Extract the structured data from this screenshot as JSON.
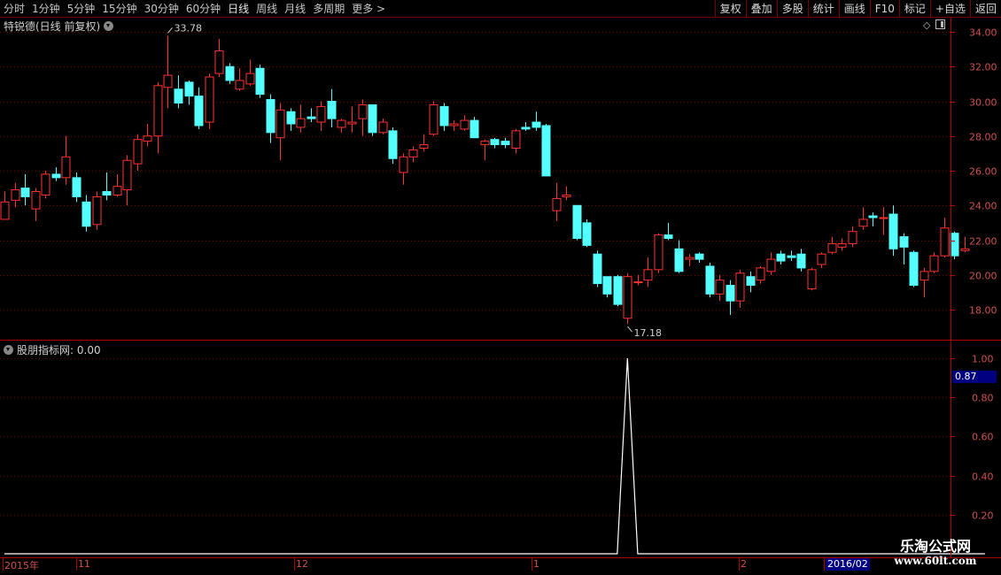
{
  "toolbar": {
    "left": [
      "分时",
      "1分钟",
      "5分钟",
      "15分钟",
      "30分钟",
      "60分钟",
      "日线",
      "周线",
      "月线",
      "多周期",
      "更多 >"
    ],
    "right": [
      "复权",
      "叠加",
      "多股",
      "统计",
      "画线",
      "F10",
      "标记",
      "+自选",
      "返回"
    ]
  },
  "stock_title": "特锐德(日线 前复权)",
  "indicator": {
    "name": "股朋指标网",
    "value": ": 0.00",
    "current": "0.87"
  },
  "price_axis": [
    "34.00",
    "32.00",
    "30.00",
    "28.00",
    "26.00",
    "24.00",
    "22.00",
    "20.00",
    "18.00"
  ],
  "indicator_axis": [
    "1.00",
    "0.80",
    "0.60",
    "0.40",
    "0.20"
  ],
  "annotations": {
    "high": "33.78",
    "low": "17.18"
  },
  "date_labels": [
    "2015年",
    "11",
    "12",
    "1",
    "2"
  ],
  "date_highlight": "2016/02",
  "watermark": {
    "line1": "乐淘公式网",
    "line2": "www.60lt.com"
  },
  "colors": {
    "up": "#ff3232",
    "down": "#54ffff",
    "grid": "#7a0000",
    "line": "#ffffff"
  },
  "chart_data": [
    {
      "type": "candlestick",
      "title": "特锐德(日线 前复权)",
      "ylim": [
        16.5,
        34.8
      ],
      "candles": [
        [
          23.2,
          24.2,
          23.3,
          24.8
        ],
        [
          24.3,
          24.9,
          23.9,
          25.3
        ],
        [
          25.0,
          24.5,
          24.0,
          25.8
        ],
        [
          23.8,
          24.8,
          23.1,
          25.0
        ],
        [
          24.6,
          25.8,
          24.4,
          26.0
        ],
        [
          25.8,
          25.6,
          25.4,
          26.2
        ],
        [
          25.6,
          26.8,
          25.2,
          28.0
        ],
        [
          25.6,
          24.5,
          24.2,
          25.9
        ],
        [
          24.2,
          22.8,
          22.5,
          24.6
        ],
        [
          22.9,
          24.5,
          22.6,
          24.8
        ],
        [
          24.8,
          24.6,
          24.3,
          25.9
        ],
        [
          24.6,
          25.1,
          24.5,
          25.8
        ],
        [
          24.9,
          26.6,
          24.0,
          26.9
        ],
        [
          26.4,
          27.8,
          26.0,
          28.1
        ],
        [
          27.7,
          28.0,
          27.4,
          28.7
        ],
        [
          28.0,
          30.9,
          27.0,
          31.1
        ],
        [
          30.8,
          31.5,
          29.6,
          33.78
        ],
        [
          30.7,
          29.9,
          29.6,
          31.5
        ],
        [
          31.1,
          30.3,
          29.8,
          31.2
        ],
        [
          30.3,
          28.6,
          28.4,
          30.8
        ],
        [
          28.8,
          31.4,
          28.4,
          31.6
        ],
        [
          31.6,
          32.9,
          31.4,
          33.6
        ],
        [
          32.0,
          31.2,
          31.0,
          32.2
        ],
        [
          30.7,
          31.2,
          30.6,
          31.9
        ],
        [
          31.0,
          31.6,
          30.9,
          32.4
        ],
        [
          31.9,
          30.4,
          30.2,
          32.1
        ],
        [
          30.1,
          28.2,
          27.6,
          30.4
        ],
        [
          27.9,
          29.5,
          26.6,
          29.9
        ],
        [
          29.4,
          28.7,
          28.3,
          29.6
        ],
        [
          28.5,
          29.0,
          28.2,
          29.8
        ],
        [
          29.1,
          29.0,
          28.8,
          29.6
        ],
        [
          28.8,
          29.7,
          28.3,
          30.0
        ],
        [
          30.0,
          29.0,
          28.5,
          30.7
        ],
        [
          28.5,
          28.9,
          28.2,
          29.0
        ],
        [
          28.7,
          28.8,
          28.2,
          29.7
        ],
        [
          29.0,
          29.8,
          28.0,
          30.1
        ],
        [
          29.8,
          28.2,
          28.0,
          29.8
        ],
        [
          28.2,
          28.8,
          28.1,
          29.0
        ],
        [
          28.3,
          26.7,
          26.4,
          28.5
        ],
        [
          25.9,
          26.8,
          25.2,
          27.0
        ],
        [
          26.8,
          27.2,
          26.5,
          27.4
        ],
        [
          27.3,
          27.5,
          27.1,
          28.1
        ],
        [
          28.1,
          29.8,
          28.0,
          30.0
        ],
        [
          29.7,
          28.6,
          28.3,
          29.9
        ],
        [
          28.6,
          28.7,
          28.3,
          28.9
        ],
        [
          28.4,
          28.9,
          28.3,
          29.2
        ],
        [
          28.9,
          27.9,
          27.9,
          29.1
        ],
        [
          27.5,
          27.7,
          26.6,
          27.8
        ],
        [
          27.8,
          27.5,
          27.3,
          27.9
        ],
        [
          27.7,
          27.5,
          27.3,
          27.9
        ],
        [
          27.3,
          28.3,
          27.0,
          28.4
        ],
        [
          28.5,
          28.4,
          28.3,
          28.8
        ],
        [
          28.8,
          28.5,
          28.3,
          29.4
        ],
        [
          28.6,
          25.7,
          25.7,
          28.7
        ],
        [
          23.7,
          24.4,
          23.1,
          25.3
        ],
        [
          24.5,
          24.6,
          24.3,
          25.1
        ],
        [
          24.0,
          22.1,
          22.0,
          24.0
        ],
        [
          23.0,
          21.7,
          21.6,
          23.2
        ],
        [
          21.2,
          19.5,
          19.3,
          21.4
        ],
        [
          19.9,
          18.9,
          18.7,
          19.9
        ],
        [
          19.9,
          18.3,
          18.2,
          20.0
        ],
        [
          17.5,
          19.9,
          17.18,
          20.1
        ],
        [
          19.6,
          19.6,
          19.4,
          20.0
        ],
        [
          19.7,
          20.3,
          19.3,
          21.0
        ],
        [
          20.3,
          22.3,
          20.1,
          22.4
        ],
        [
          22.3,
          22.1,
          22.0,
          23.0
        ],
        [
          21.5,
          20.2,
          20.1,
          22.0
        ],
        [
          20.9,
          21.0,
          20.5,
          21.2
        ],
        [
          21.2,
          20.9,
          20.7,
          21.3
        ],
        [
          20.5,
          18.9,
          18.7,
          20.7
        ],
        [
          18.9,
          19.7,
          18.5,
          20.0
        ],
        [
          19.4,
          18.5,
          17.7,
          19.7
        ],
        [
          18.5,
          20.1,
          18.1,
          20.3
        ],
        [
          19.9,
          19.4,
          19.0,
          20.2
        ],
        [
          19.7,
          20.4,
          19.5,
          20.5
        ],
        [
          20.2,
          20.9,
          20.0,
          21.3
        ],
        [
          21.2,
          20.8,
          20.6,
          21.4
        ],
        [
          21.1,
          21.0,
          20.8,
          21.4
        ],
        [
          21.2,
          20.4,
          20.2,
          21.5
        ],
        [
          19.2,
          20.3,
          19.1,
          20.4
        ],
        [
          20.6,
          21.2,
          20.4,
          21.3
        ],
        [
          21.3,
          21.8,
          21.2,
          22.2
        ],
        [
          21.6,
          21.8,
          21.4,
          22.1
        ],
        [
          21.8,
          22.5,
          21.6,
          22.8
        ],
        [
          22.8,
          23.2,
          22.6,
          23.9
        ],
        [
          23.4,
          23.3,
          22.8,
          23.6
        ],
        [
          23.3,
          23.3,
          22.3,
          23.9
        ],
        [
          23.5,
          21.5,
          21.1,
          24.0
        ],
        [
          22.2,
          21.6,
          20.6,
          22.4
        ],
        [
          21.3,
          19.4,
          19.3,
          21.4
        ],
        [
          19.7,
          20.2,
          18.7,
          20.4
        ],
        [
          20.2,
          21.1,
          20.1,
          21.3
        ],
        [
          21.1,
          22.7,
          21.0,
          23.3
        ],
        [
          22.4,
          21.1,
          20.9,
          22.5
        ],
        [
          21.4,
          21.5,
          21.3,
          22.2
        ]
      ]
    },
    {
      "type": "line",
      "title": "股朋指标网",
      "ylim": [
        0,
        1.1
      ],
      "values_note": "zero everywhere except index 61 (low day) where value = 1.00",
      "values": [
        0,
        0,
        0,
        0,
        0,
        0,
        0,
        0,
        0,
        0,
        0,
        0,
        0,
        0,
        0,
        0,
        0,
        0,
        0,
        0,
        0,
        0,
        0,
        0,
        0,
        0,
        0,
        0,
        0,
        0,
        0,
        0,
        0,
        0,
        0,
        0,
        0,
        0,
        0,
        0,
        0,
        0,
        0,
        0,
        0,
        0,
        0,
        0,
        0,
        0,
        0,
        0,
        0,
        0,
        0,
        0,
        0,
        0,
        0,
        0,
        0,
        1.0,
        0,
        0,
        0,
        0,
        0,
        0,
        0,
        0,
        0,
        0,
        0,
        0,
        0,
        0,
        0,
        0,
        0,
        0,
        0,
        0,
        0,
        0,
        0,
        0,
        0,
        0,
        0,
        0,
        0,
        0,
        0,
        0,
        0,
        0,
        0
      ]
    }
  ]
}
